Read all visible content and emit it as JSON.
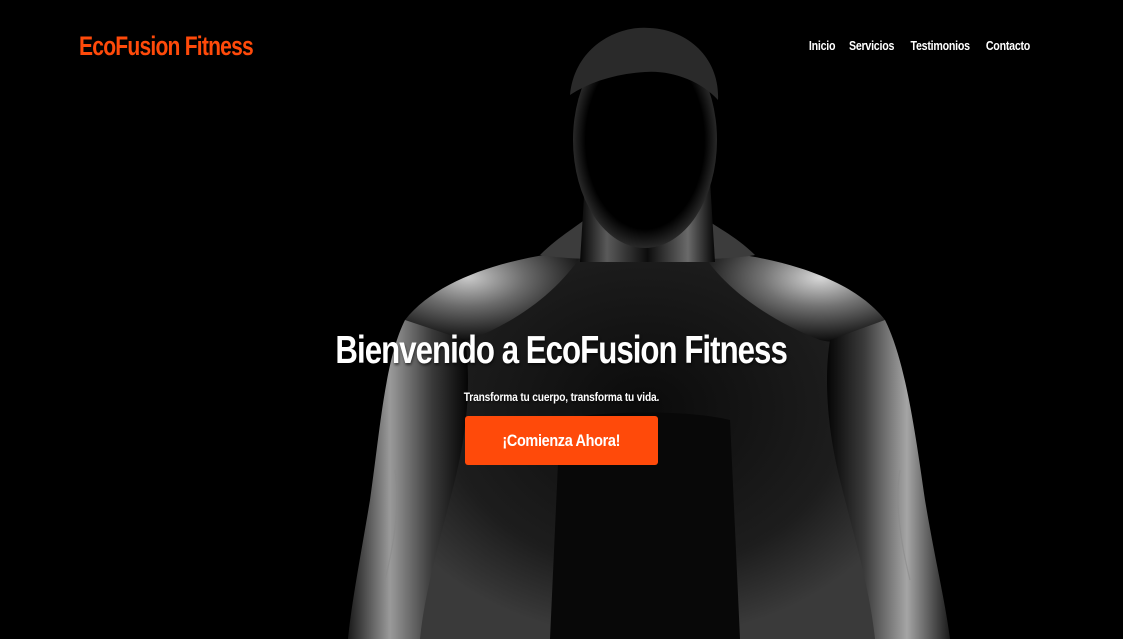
{
  "brand": {
    "name": "EcoFusion Fitness",
    "accent_color": "#ff4a0a"
  },
  "nav": {
    "items": [
      {
        "label": "Inicio"
      },
      {
        "label": "Servicios"
      },
      {
        "label": "Testimonios"
      },
      {
        "label": "Contacto"
      }
    ]
  },
  "hero": {
    "title": "Bienvenido a EcoFusion Fitness",
    "subtitle": "Transforma tu cuerpo, transforma tu vida.",
    "cta_label": "¡Comienza Ahora!",
    "background_image": "muscular-man-silhouette-photo"
  }
}
